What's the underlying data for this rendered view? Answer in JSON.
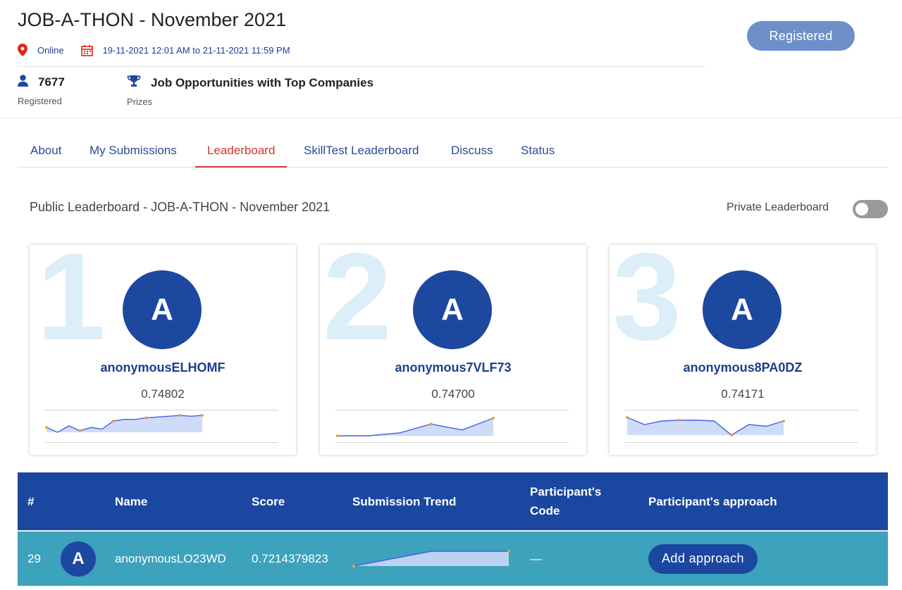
{
  "header": {
    "title": "JOB-A-THON - November 2021",
    "location": "Online",
    "dates": "19-11-2021 12:01 AM to 21-11-2021 11:59 PM",
    "registered_count": "7677",
    "registered_label": "Registered",
    "prize_text": "Job Opportunities with Top Companies",
    "prize_label": "Prizes",
    "register_button": "Registered"
  },
  "tabs": [
    {
      "label": "About",
      "active": false
    },
    {
      "label": "My Submissions",
      "active": false
    },
    {
      "label": "Leaderboard",
      "active": true
    },
    {
      "label": "SkillTest Leaderboard",
      "active": false
    },
    {
      "label": "Discuss",
      "active": false
    },
    {
      "label": "Status",
      "active": false
    }
  ],
  "leaderboard": {
    "title": "Public Leaderboard - JOB-A-THON - November 2021",
    "private_label": "Private Leaderboard",
    "private_enabled": false
  },
  "top3": [
    {
      "rank": "1",
      "initial": "A",
      "name": "anonymousELHOMF",
      "score": "0.74802",
      "trend": [
        0.745,
        0.742,
        0.746,
        0.743,
        0.745,
        0.744,
        0.749,
        0.75,
        0.75,
        0.751,
        0.7515,
        0.752,
        0.7525,
        0.752,
        0.7525
      ]
    },
    {
      "rank": "2",
      "initial": "A",
      "name": "anonymous7VLF73",
      "score": "0.74700",
      "trend": [
        0.74,
        0.74,
        0.741,
        0.744,
        0.742,
        0.746
      ]
    },
    {
      "rank": "3",
      "initial": "A",
      "name": "anonymous8PA0DZ",
      "score": "0.74171",
      "trend": [
        0.746,
        0.742,
        0.744,
        0.7445,
        0.7445,
        0.744,
        0.736,
        0.742,
        0.741,
        0.744
      ]
    }
  ],
  "table": {
    "headers": {
      "rank": "#",
      "name": "Name",
      "score": "Score",
      "trend": "Submission Trend",
      "code_line1": "Participant's",
      "code_line2": "Code",
      "approach": "Participant's approach"
    },
    "rows": [
      {
        "rank": "29",
        "initial": "A",
        "name": "anonymousLO23WD",
        "score": "0.7214379823",
        "code": "—",
        "approach_button": "Add approach",
        "trend": [
          0.7,
          0.721,
          0.721
        ]
      }
    ]
  },
  "colors": {
    "primary": "#1b47a0",
    "accent_red": "#d0372a",
    "row_teal": "#3da2bb",
    "rank_watermark": "#dceef8",
    "registered_button": "#6f8fcb"
  }
}
